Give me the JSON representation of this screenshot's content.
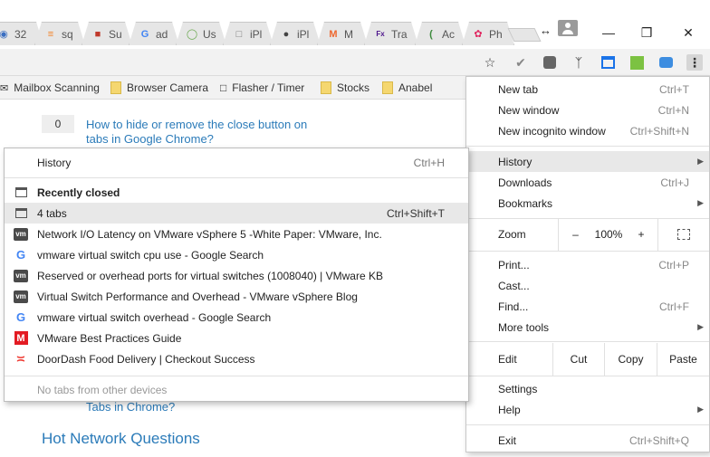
{
  "tabs": [
    {
      "label": "32",
      "icon": "globe-icon",
      "color": "#3b6fc2"
    },
    {
      "label": "sq",
      "icon": "stack-icon",
      "color": "#f48024"
    },
    {
      "label": "Su",
      "icon": "cube-icon",
      "color": "#c0392b"
    },
    {
      "label": "ad",
      "icon": "google-icon",
      "color": "#4285f4"
    },
    {
      "label": "Us",
      "icon": "circle-icon",
      "color": "#6aa84f"
    },
    {
      "label": "iPl",
      "icon": "page-icon",
      "color": "#777777"
    },
    {
      "label": "iPl",
      "icon": "apple-icon",
      "color": "#444444"
    },
    {
      "label": "M",
      "icon": "magento-icon",
      "color": "#ee672f"
    },
    {
      "label": "Tra",
      "icon": "fedex-icon",
      "color": "#4d148c"
    },
    {
      "label": "Ac",
      "icon": "leaf-icon",
      "color": "#3c8a3c"
    },
    {
      "label": "Ph",
      "icon": "flower-icon",
      "color": "#e0245e"
    }
  ],
  "window": {
    "minimize": "—",
    "restore": "❒",
    "close": "✕",
    "resize": "↔"
  },
  "bookmarks": [
    {
      "label": "Mailbox Scanning",
      "icon": "mailbox-icon"
    },
    {
      "label": "Browser Camera",
      "icon": "folder-icon"
    },
    {
      "label": "Flasher / Timer",
      "icon": "page-icon"
    },
    {
      "label": "Stocks",
      "icon": "folder-icon"
    },
    {
      "label": "Anabel",
      "icon": "folder-icon"
    }
  ],
  "page": {
    "votes": "0",
    "question1": "How to hide or remove the close button on tabs in Google Chrome?",
    "question2_tail": "Tabs in Chrome?",
    "hot_network": "Hot Network Questions"
  },
  "history_menu": {
    "header": "History",
    "header_shortcut": "Ctrl+H",
    "recently_closed": "Recently closed",
    "items": [
      {
        "label": "4 tabs",
        "shortcut": "Ctrl+Shift+T",
        "icon": "window-icon"
      },
      {
        "label": "Network I/O Latency on VMware vSphere 5 -White Paper: VMware, Inc.",
        "icon": "vmware-icon"
      },
      {
        "label": "vmware virtual switch cpu use - Google Search",
        "icon": "google-icon"
      },
      {
        "label": "Reserved or overhead ports for virtual switches (1008040) | VMware KB",
        "icon": "vmware-icon"
      },
      {
        "label": "Virtual Switch Performance and Overhead - VMware vSphere Blog",
        "icon": "vmware-icon"
      },
      {
        "label": "vmware virtual switch overhead - Google Search",
        "icon": "google-icon"
      },
      {
        "label": "VMware Best Practices Guide",
        "icon": "gmail-icon"
      },
      {
        "label": "DoorDash Food Delivery | Checkout Success",
        "icon": "doordash-icon"
      }
    ],
    "no_devices": "No tabs from other devices"
  },
  "main_menu": {
    "new_tab": "New tab",
    "new_tab_sc": "Ctrl+T",
    "new_window": "New window",
    "new_window_sc": "Ctrl+N",
    "incognito": "New incognito window",
    "incognito_sc": "Ctrl+Shift+N",
    "history": "History",
    "downloads": "Downloads",
    "downloads_sc": "Ctrl+J",
    "bookmarks": "Bookmarks",
    "zoom": "Zoom",
    "zoom_minus": "–",
    "zoom_value": "100%",
    "zoom_plus": "+",
    "print": "Print...",
    "print_sc": "Ctrl+P",
    "cast": "Cast...",
    "find": "Find...",
    "find_sc": "Ctrl+F",
    "more_tools": "More tools",
    "edit": "Edit",
    "cut": "Cut",
    "copy": "Copy",
    "paste": "Paste",
    "settings": "Settings",
    "help": "Help",
    "exit": "Exit",
    "exit_sc": "Ctrl+Shift+Q"
  }
}
